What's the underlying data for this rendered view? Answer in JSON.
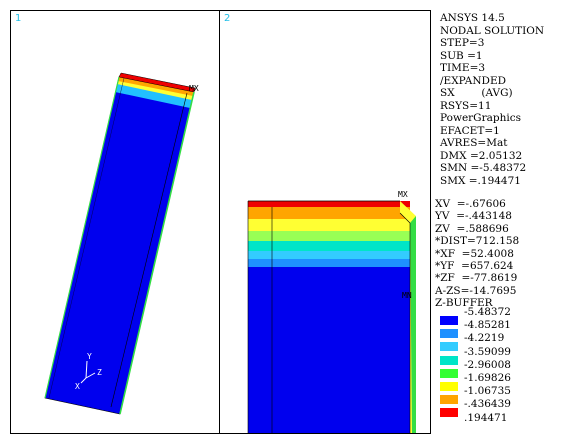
{
  "viewports": [
    {
      "number": "1",
      "max_label": "MX"
    },
    {
      "number": "2",
      "max_label": "MX",
      "min_label": "MN"
    }
  ],
  "info": {
    "lines": [
      "ANSYS 14.5",
      "NODAL SOLUTION",
      "STEP=3",
      "SUB =1",
      "TIME=3",
      "/EXPANDED",
      "SX        (AVG)",
      "RSYS=11",
      "PowerGraphics",
      "EFACET=1",
      "AVRES=Mat",
      "DMX =2.05132",
      "SMN =-5.48372",
      "SMX =.194471"
    ]
  },
  "view_params": {
    "lines": [
      "XV  =-.67606",
      "YV  =-.443148",
      "ZV  =.588696",
      "*DIST=712.158",
      "*XF  =52.4008",
      "*YF  =657.624",
      "*ZF  =-77.8619",
      "A-ZS=-14.7695",
      "Z-BUFFER"
    ]
  },
  "triad": {
    "y_label": "Y",
    "z_label": "Z",
    "x_label": "X"
  },
  "legend": {
    "values": [
      "-5.48372",
      "-4.85281",
      "-4.2219",
      "-3.59099",
      "-2.96008",
      "-1.69826",
      "-1.06735",
      "-.436439",
      ".194471"
    ],
    "colors": [
      "#0000ff",
      "#1e90ff",
      "#33ccff",
      "#00e5c8",
      "#33ff33",
      "#ffff00",
      "#ffa500",
      "#ff0000"
    ]
  }
}
